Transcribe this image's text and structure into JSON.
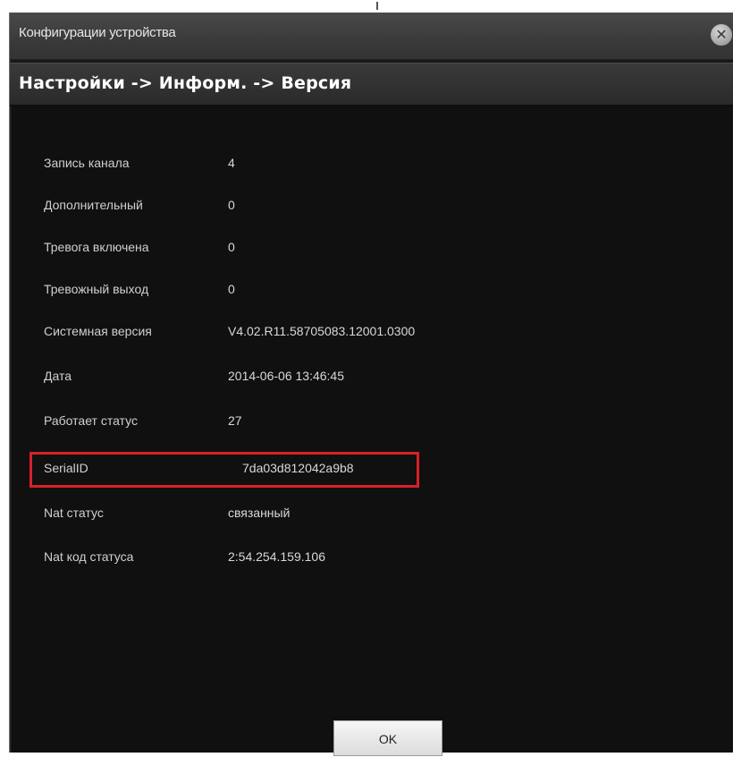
{
  "window": {
    "title": "Конфигурации устройства",
    "breadcrumb": "Настройки -> Информ. -> Версия"
  },
  "info_rows": [
    {
      "label": "Запись канала",
      "value": "4"
    },
    {
      "label": "Дополнительный",
      "value": "0"
    },
    {
      "label": "Тревога включена",
      "value": "0"
    },
    {
      "label": "Тревожный выход",
      "value": "0"
    },
    {
      "label": "Системная версия",
      "value": "V4.02.R11.58705083.12001.0300"
    },
    {
      "label": "Дата",
      "value": "2014-06-06 13:46:45"
    },
    {
      "label": "Работает статус",
      "value": "27"
    },
    {
      "label": "SerialID",
      "value": "7da03d812042a9b8"
    },
    {
      "label": "Nat статус",
      "value": "связанный"
    },
    {
      "label": "Nat код статуса",
      "value": "2:54.254.159.106"
    }
  ],
  "buttons": {
    "ok_label": "OK",
    "close_icon": "close-icon"
  },
  "colors": {
    "dialog_bg": "#181818",
    "highlight": "#d8202a"
  }
}
